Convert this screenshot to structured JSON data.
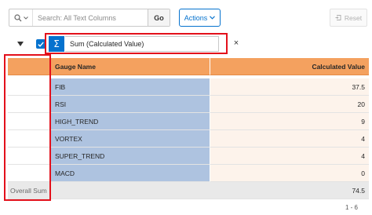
{
  "toolbar": {
    "search_placeholder": "Search: All Text Columns",
    "go_label": "Go",
    "actions_label": "Actions",
    "reset_label": "Reset",
    "search_icon": "search-icon",
    "reset_icon": "reset-icon"
  },
  "filter": {
    "checked": true,
    "icon": "sigma-icon",
    "text": "Sum (Calculated Value)",
    "remove_symbol": "×"
  },
  "grid": {
    "columns": [
      "",
      "Gauge Name",
      "Calculated Value"
    ],
    "rows": [
      {
        "gauge": "FIB",
        "value": "37.5"
      },
      {
        "gauge": "RSI",
        "value": "20"
      },
      {
        "gauge": "HIGH_TREND",
        "value": "9"
      },
      {
        "gauge": "VORTEX",
        "value": "4"
      },
      {
        "gauge": "SUPER_TREND",
        "value": "4"
      },
      {
        "gauge": "MACD",
        "value": "0"
      }
    ],
    "summary": {
      "label": "Overall Sum",
      "value": "74.5"
    }
  },
  "pagination": "1 - 6",
  "colors": {
    "header_bg": "#f4a15f",
    "gauge_col_bg": "#aec3e0",
    "value_col_bg": "#fdf3eb",
    "accent": "#0572ce",
    "highlight": "#e3101b"
  }
}
